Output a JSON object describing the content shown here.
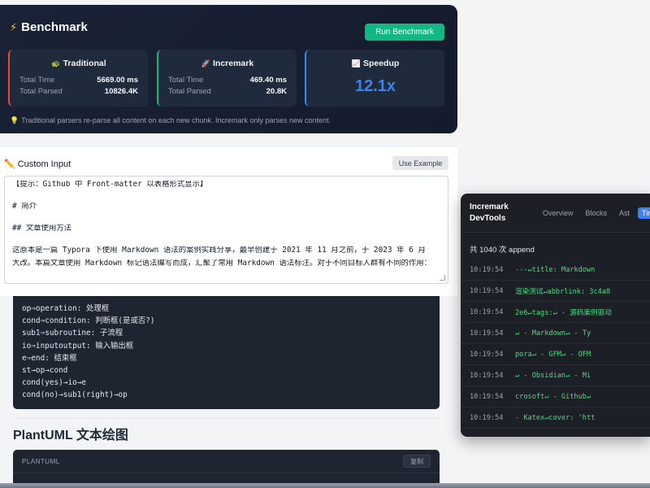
{
  "benchmark": {
    "title": "Benchmark",
    "run_label": "Run Benchmark",
    "cards": [
      {
        "title": "Traditional",
        "icon": "🐢",
        "total_time_label": "Total Time",
        "total_time": "5669.00 ms",
        "total_parsed_label": "Total Parsed",
        "total_parsed": "10826.4K"
      },
      {
        "title": "Incremark",
        "icon": "🚀",
        "total_time_label": "Total Time",
        "total_time": "469.40 ms",
        "total_parsed_label": "Total Parsed",
        "total_parsed": "20.8K"
      }
    ],
    "speedup": {
      "title": "Speedup",
      "icon": "📈",
      "value": "12.1x"
    },
    "note": "Traditional parsers re-parse all content on each new chunk. Incremark only parses new content.",
    "colors": {
      "accent_run": "#10b981",
      "traditional": "#ef4444",
      "incremark": "#10b981",
      "speedup": "#3b82f6"
    }
  },
  "custom_input": {
    "title": "Custom Input",
    "use_example_label": "Use Example",
    "lines": [
      "【提示：Github 中 Front-matter 以表格形式显示】",
      "",
      "# 简介",
      "",
      "## 文章使用方法",
      "",
      "这原本是一篇 Typora 下使用 Markdown 语法的案例实践分享，最早创建于 2021 年 11 月之前，于 2023 年 6 月",
      "大改。本篇文章使用 Markdown 标记语法编写而成，汇聚了常用 Markdown 语法标注。对于不同目标人群有不同的作用："
    ]
  },
  "flow_code": {
    "lines": [
      "op⇒operation: 处理框",
      "cond⇒condition: 判断框(是或否?)",
      "sub1⇒subroutine: 子流程",
      "io⇒inputoutput: 输入输出框",
      "e⇒end: 结束框",
      "st→op→cond",
      "cond(yes)→io→e",
      "cond(no)→sub1(right)→op"
    ]
  },
  "plantuml": {
    "heading": "PlantUML 文本绘图",
    "lang": "PLANTUML",
    "copy_label": "复制"
  },
  "devtools": {
    "title_line1": "Incremark",
    "title_line2": "DevTools",
    "tabs": [
      "Overview",
      "Blocks",
      "Ast",
      "Time"
    ],
    "active_tab": "Time",
    "count_text": "共 1040 次 append",
    "rows": [
      {
        "time": "10:19:54",
        "content": "---↵title: Markdown"
      },
      {
        "time": "10:19:54",
        "content": "渲染测试↵abbrlink: 3c4a8"
      },
      {
        "time": "10:19:54",
        "content": "2e6↵tags:↵ - 源码案例驱动"
      },
      {
        "time": "10:19:54",
        "content": "↵ - Markdown↵ - Ty"
      },
      {
        "time": "10:19:54",
        "content": "pora↵ - GFM↵ - OFM"
      },
      {
        "time": "10:19:54",
        "content": "↵ - Obsidian↵ - Mi"
      },
      {
        "time": "10:19:54",
        "content": "crosoft↵ - Github↵"
      },
      {
        "time": "10:19:54",
        "content": " - Katex↵cover: 'htt"
      }
    ]
  }
}
